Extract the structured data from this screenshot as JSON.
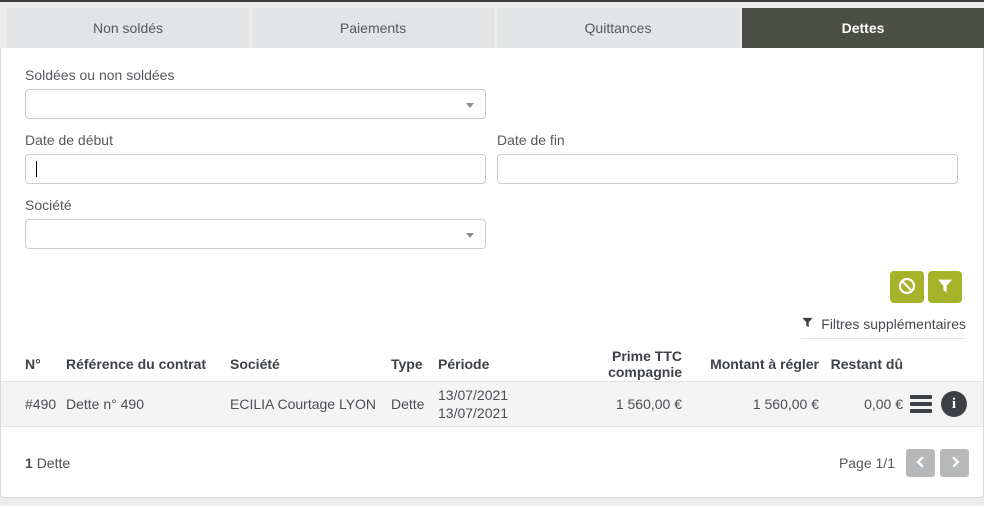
{
  "tabs": [
    {
      "label": "Non soldés",
      "active": false
    },
    {
      "label": "Paiements",
      "active": false
    },
    {
      "label": "Quittances",
      "active": false
    },
    {
      "label": "Dettes",
      "active": true
    }
  ],
  "filters": {
    "soldees": {
      "label": "Soldées ou non soldées",
      "value": ""
    },
    "date_debut": {
      "label": "Date de début",
      "value": ""
    },
    "date_fin": {
      "label": "Date de fin",
      "value": ""
    },
    "societe": {
      "label": "Société",
      "value": ""
    },
    "clear_button_icon": "ban-icon",
    "apply_button_icon": "funnel-icon",
    "extra_filters_label": "Filtres supplémentaires"
  },
  "table": {
    "headers": {
      "numero": "N°",
      "reference": "Référence du contrat",
      "societe": "Société",
      "type": "Type",
      "periode": "Période",
      "prime": "Prime TTC compagnie",
      "montant": "Montant à régler",
      "restant": "Restant dû"
    },
    "rows": [
      {
        "numero": "#490",
        "reference": "Dette n° 490",
        "societe": "ECILIA Courtage LYON",
        "type": "Dette",
        "periode_debut": "13/07/2021",
        "periode_fin": "13/07/2021",
        "prime": "1 560,00 €",
        "montant": "1 560,00 €",
        "restant": "0,00 €",
        "row_icons": [
          "menu-icon",
          "info-icon"
        ]
      }
    ]
  },
  "footer": {
    "count_value": "1",
    "count_label": "Dette",
    "page_label": "Page 1/1",
    "pager_icons": [
      "chevron-left-icon",
      "chevron-right-icon"
    ]
  },
  "colors": {
    "active_tab": "#4a4e45",
    "inactive_tab": "#e3e4e6",
    "accent_olive": "#a6b227",
    "dark_icon": "#3d4145",
    "pager_gray": "#b6b8ba"
  }
}
